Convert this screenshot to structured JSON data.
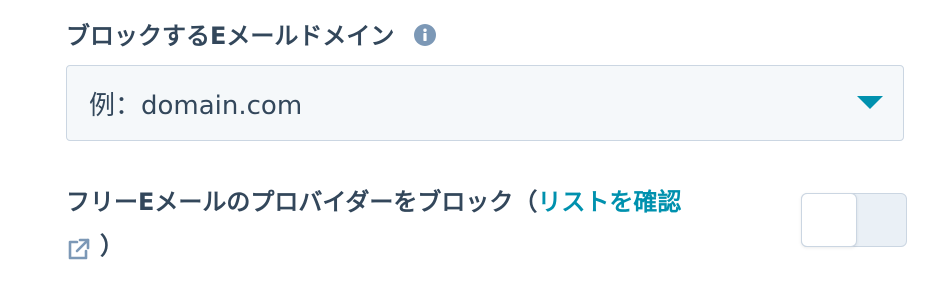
{
  "blocked_domains": {
    "label": "ブロックするEメールドメイン",
    "info_icon": "info-circle-icon",
    "select": {
      "placeholder": "例：domain.com",
      "caret_icon": "caret-down-icon",
      "caret_color": "#0091ae"
    }
  },
  "free_email": {
    "label_prefix": "フリーEメールのプロバイダーをブロック（",
    "link_text": "リストを確認",
    "link_icon": "external-link-icon",
    "label_suffix": "）",
    "toggle": {
      "state": "off"
    }
  },
  "colors": {
    "text": "#33475b",
    "link": "#0091ae",
    "field_bg": "#f5f8fa",
    "border": "#cbd6e2",
    "toggle_bg": "#eaf0f6",
    "icon_muted": "#7c98b6"
  }
}
